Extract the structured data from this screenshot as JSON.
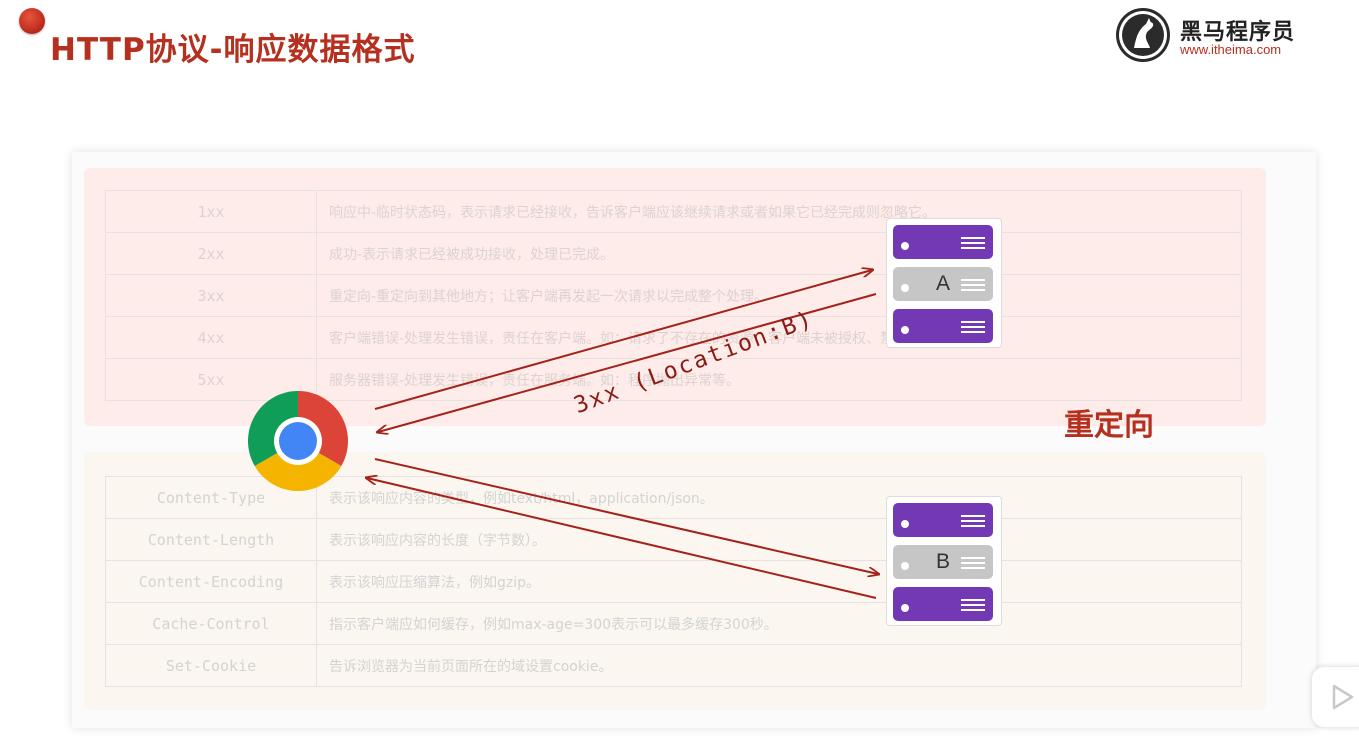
{
  "slide": {
    "title": "HTTP协议-响应数据格式"
  },
  "logo": {
    "name": "黑马程序员",
    "url": "www.itheima.com"
  },
  "status_codes": [
    {
      "code": "1xx",
      "desc": "响应中-临时状态码，表示请求已经接收，告诉客户端应该继续请求或者如果它已经完成则忽略它。"
    },
    {
      "code": "2xx",
      "desc": "成功-表示请求已经被成功接收，处理已完成。"
    },
    {
      "code": "3xx",
      "desc": "重定向-重定向到其他地方；让客户端再发起一次请求以完成整个处理。"
    },
    {
      "code": "4xx",
      "desc": "客户端错误-处理发生错误，责任在客户端。如：请求了不存在的资源、客户端未被授权、禁止访问等。"
    },
    {
      "code": "5xx",
      "desc": "服务器错误-处理发生错误，责任在服务端。如：程序抛出异常等。"
    }
  ],
  "response_headers": [
    {
      "name": "Content-Type",
      "desc": "表示该响应内容的类型，例如text/html，application/json。"
    },
    {
      "name": "Content-Length",
      "desc": "表示该响应内容的长度（字节数）。"
    },
    {
      "name": "Content-Encoding",
      "desc": "表示该响应压缩算法，例如gzip。"
    },
    {
      "name": "Cache-Control",
      "desc": "指示客户端应如何缓存，例如max-age=300表示可以最多缓存300秒。"
    },
    {
      "name": "Set-Cookie",
      "desc": "告诉浏览器为当前页面所在的域设置cookie。"
    }
  ],
  "diagram": {
    "server_a_label": "A",
    "server_b_label": "B",
    "redirect_response_label": "3xx (Location:B)",
    "concept_label": "重定向"
  },
  "colors": {
    "title": "#b5301f",
    "arrow": "#a4221a",
    "server_slot": "#7339b5",
    "server_slot_active": "#c6c6c6"
  },
  "icons": [
    "chrome-browser-icon",
    "server-rack-icon",
    "play-icon",
    "horse-logo-icon"
  ]
}
